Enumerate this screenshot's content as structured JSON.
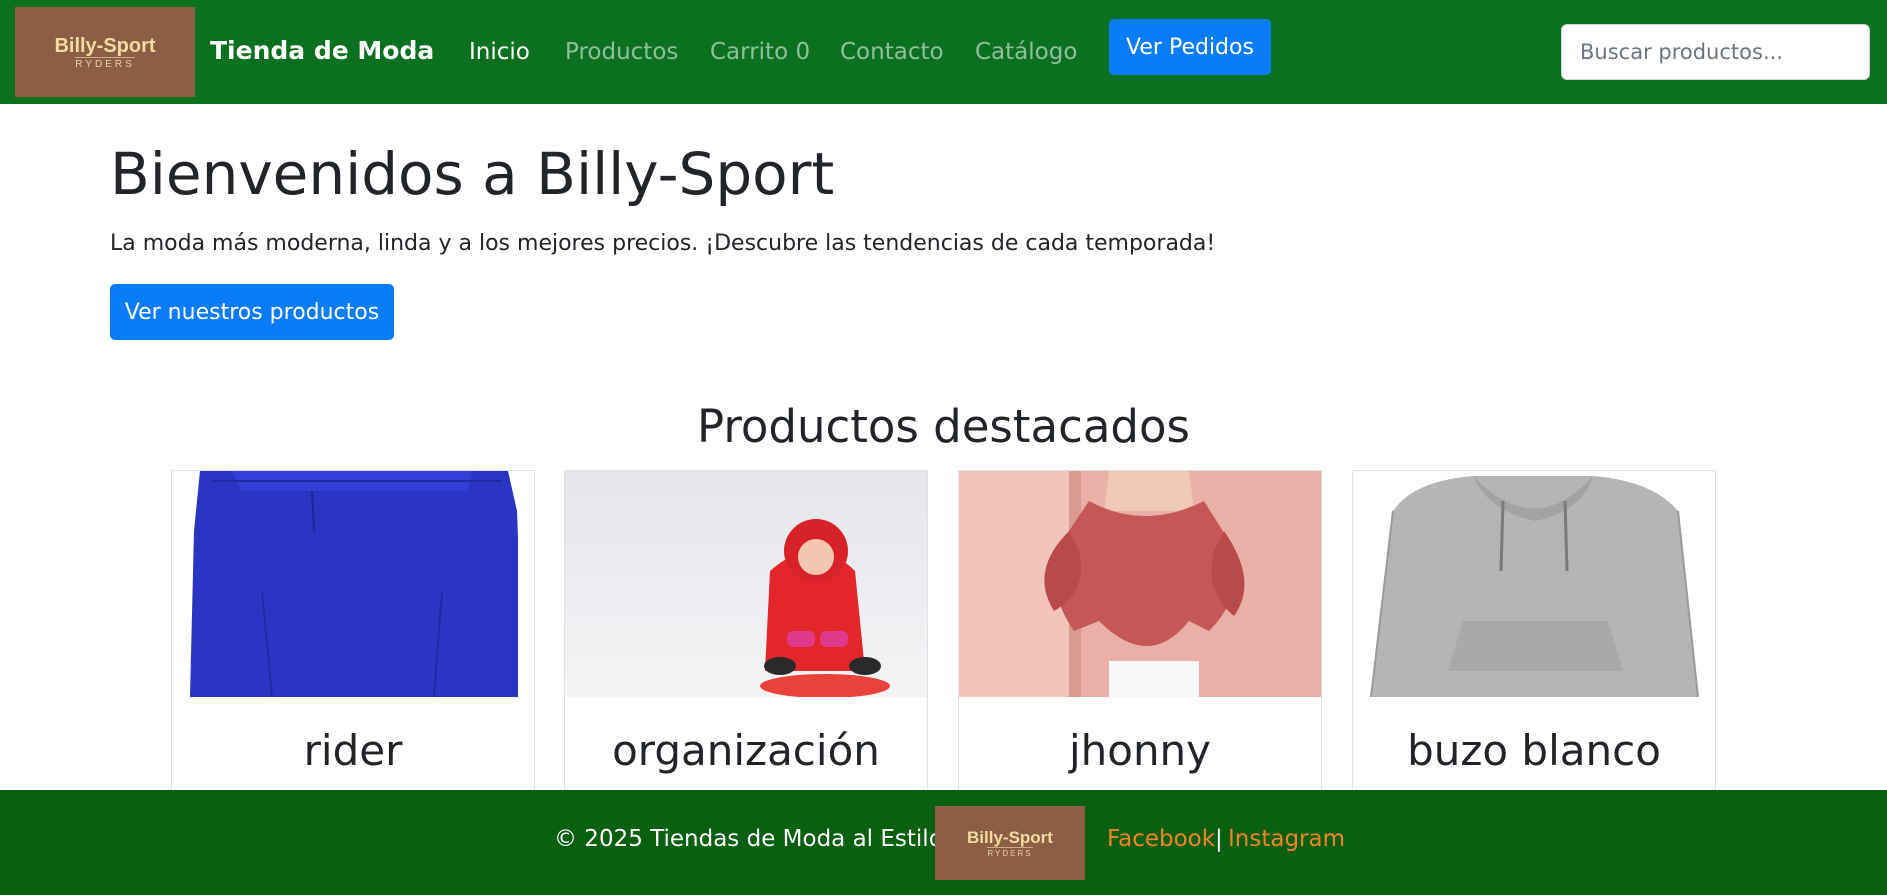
{
  "header": {
    "logo": {
      "main": "Billy-Sport",
      "sub": "RYDERS"
    },
    "brand": "Tienda de Moda",
    "nav": [
      {
        "label": "Inicio",
        "active": true
      },
      {
        "label": "Productos",
        "active": false
      },
      {
        "label": "Carrito 0",
        "active": false
      },
      {
        "label": "Contacto",
        "active": false
      },
      {
        "label": "Catálogo",
        "active": false
      }
    ],
    "orders_button": "Ver Pedidos",
    "search": {
      "placeholder": "Buscar productos...",
      "value": ""
    }
  },
  "hero": {
    "title": "Bienvenidos a Billy-Sport",
    "description": "La moda más moderna, linda y a los mejores precios. ¡Descubre las tendencias de cada temporada!",
    "button": "Ver nuestros productos"
  },
  "featured": {
    "title": "Productos destacados",
    "products": [
      {
        "name": "rider",
        "image": "blue-sweater-photo"
      },
      {
        "name": "organización",
        "image": "child-red-snowsuit-photo"
      },
      {
        "name": "jhonny",
        "image": "ruffled-blouse-photo"
      },
      {
        "name": "buzo blanco",
        "image": "grey-hoodie-photo"
      }
    ]
  },
  "footer": {
    "copyright": "© 2025 Tiendas de Moda al Estilo",
    "logo": {
      "main": "Billy-Sport",
      "sub": "RYDERS"
    },
    "links": [
      "Facebook",
      "Instagram"
    ],
    "separator": "|"
  },
  "colors": {
    "navbar": "#0b7121",
    "footer": "#086010",
    "primary": "#0a7cf7",
    "footer_link": "#f0822a",
    "logo_bg": "#8b5e45"
  }
}
